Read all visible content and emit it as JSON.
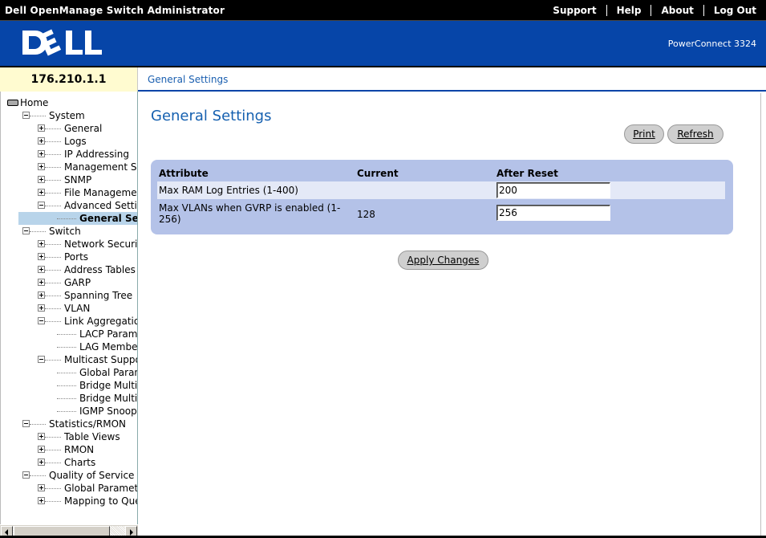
{
  "app": {
    "title": "Dell OpenManage Switch Administrator",
    "product": "PowerConnect 3324",
    "logo_text": "DELL"
  },
  "topnav": [
    {
      "label": "Support"
    },
    {
      "label": "Help"
    },
    {
      "label": "About"
    },
    {
      "label": "Log Out"
    }
  ],
  "device": {
    "ip": "176.210.1.1"
  },
  "breadcrumb": "General Settings",
  "sidebar": {
    "items": [
      {
        "label": "Home",
        "level": 0,
        "type": "home"
      },
      {
        "label": "System",
        "level": 1,
        "exp": "minus"
      },
      {
        "label": "General",
        "level": 2,
        "exp": "plus"
      },
      {
        "label": "Logs",
        "level": 2,
        "exp": "plus"
      },
      {
        "label": "IP Addressing",
        "level": 2,
        "exp": "plus"
      },
      {
        "label": "Management Se",
        "level": 2,
        "exp": "plus"
      },
      {
        "label": "SNMP",
        "level": 2,
        "exp": "plus"
      },
      {
        "label": "File Managemen",
        "level": 2,
        "exp": "plus"
      },
      {
        "label": "Advanced Settin",
        "level": 2,
        "exp": "minus"
      },
      {
        "label": "General Set",
        "level": 3,
        "exp": "none",
        "selected": true
      },
      {
        "label": "Switch",
        "level": 1,
        "exp": "minus"
      },
      {
        "label": "Network Securit",
        "level": 2,
        "exp": "plus"
      },
      {
        "label": "Ports",
        "level": 2,
        "exp": "plus"
      },
      {
        "label": "Address Tables",
        "level": 2,
        "exp": "plus"
      },
      {
        "label": "GARP",
        "level": 2,
        "exp": "plus"
      },
      {
        "label": "Spanning Tree",
        "level": 2,
        "exp": "plus"
      },
      {
        "label": "VLAN",
        "level": 2,
        "exp": "plus"
      },
      {
        "label": "Link Aggregation",
        "level": 2,
        "exp": "minus"
      },
      {
        "label": "LACP Param",
        "level": 3,
        "exp": "none"
      },
      {
        "label": "LAG Membe",
        "level": 3,
        "exp": "none"
      },
      {
        "label": "Multicast Suppo",
        "level": 2,
        "exp": "minus"
      },
      {
        "label": "Global Paran",
        "level": 3,
        "exp": "none"
      },
      {
        "label": "Bridge Multic",
        "level": 3,
        "exp": "none"
      },
      {
        "label": "Bridge Multic",
        "level": 3,
        "exp": "none"
      },
      {
        "label": "IGMP Snoop",
        "level": 3,
        "exp": "none"
      },
      {
        "label": "Statistics/RMON",
        "level": 1,
        "exp": "minus"
      },
      {
        "label": "Table Views",
        "level": 2,
        "exp": "plus"
      },
      {
        "label": "RMON",
        "level": 2,
        "exp": "plus"
      },
      {
        "label": "Charts",
        "level": 2,
        "exp": "plus"
      },
      {
        "label": "Quality of Service",
        "level": 1,
        "exp": "minus"
      },
      {
        "label": "Global Paramete",
        "level": 2,
        "exp": "plus"
      },
      {
        "label": "Mapping to Que",
        "level": 2,
        "exp": "plus"
      }
    ]
  },
  "main": {
    "title": "General Settings",
    "print_label": "Print",
    "refresh_label": "Refresh",
    "apply_label": "Apply Changes",
    "table": {
      "headers": {
        "attribute": "Attribute",
        "current": "Current",
        "after_reset": "After Reset"
      },
      "rows": [
        {
          "attribute": "Max RAM Log Entries (1-400)",
          "current": "",
          "after_reset": "200"
        },
        {
          "attribute": "Max VLANs when GVRP is enabled (1-256)",
          "current": "128",
          "after_reset": "256"
        }
      ]
    }
  },
  "colors": {
    "banner": "#0645a8",
    "panel": "#b4c2e8",
    "title": "#1560b0",
    "address_bg": "#fffbd0"
  }
}
